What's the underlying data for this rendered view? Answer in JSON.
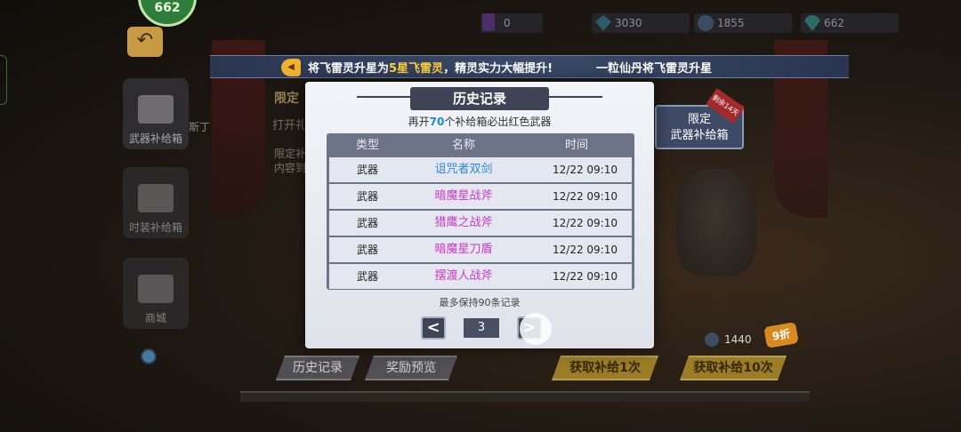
{
  "resources": {
    "cards": "0",
    "crystal": "3030",
    "coins": "1855",
    "gems": "662"
  },
  "top_badge": "662",
  "announcement": {
    "part1": "将飞雷灵升星为",
    "highlight": "5星飞雷灵",
    "part2": "，精灵实力大幅提升!",
    "right": "一粒仙丹将飞雷灵升星"
  },
  "sidebar": {
    "weapon_label": "武器补给箱",
    "fashion_label": "时装补给箱",
    "shop_label": "商城"
  },
  "background": {
    "title": "限定",
    "subtitle": "打开礼",
    "text1": "限定补",
    "text2": "内容到",
    "side_label": "斯丁",
    "limited_line1": "限定",
    "limited_line2": "武器补给箱",
    "limited_tag": "剩余14天",
    "discount": "9折",
    "cost": "1440",
    "btn_history": "历史记录",
    "btn_preview": "奖励预览",
    "btn_once": "获取补给1次",
    "btn_ten": "获取补给10次"
  },
  "modal": {
    "title": "历史记录",
    "guarantee_prefix": "再开",
    "guarantee_num": "70",
    "guarantee_suffix": "个补给箱必出红色武器",
    "columns": [
      "类型",
      "名称",
      "时间"
    ],
    "rows": [
      {
        "type": "武器",
        "name": "诅咒者双剑",
        "name_color": "#2a8ad8",
        "time": "12/22  09:10"
      },
      {
        "type": "武器",
        "name": "暗魔星战斧",
        "name_color": "#c83ac8",
        "time": "12/22  09:10"
      },
      {
        "type": "武器",
        "name": "猎鹰之战斧",
        "name_color": "#c83ac8",
        "time": "12/22  09:10"
      },
      {
        "type": "武器",
        "name": "暗魔星刀盾",
        "name_color": "#c83ac8",
        "time": "12/22  09:10"
      },
      {
        "type": "武器",
        "name": "摆渡人战斧",
        "name_color": "#c83ac8",
        "time": "12/22  09:10"
      }
    ],
    "max_note": "最多保持90条记录",
    "page": "3",
    "prev_label": "<",
    "next_label": ">"
  }
}
